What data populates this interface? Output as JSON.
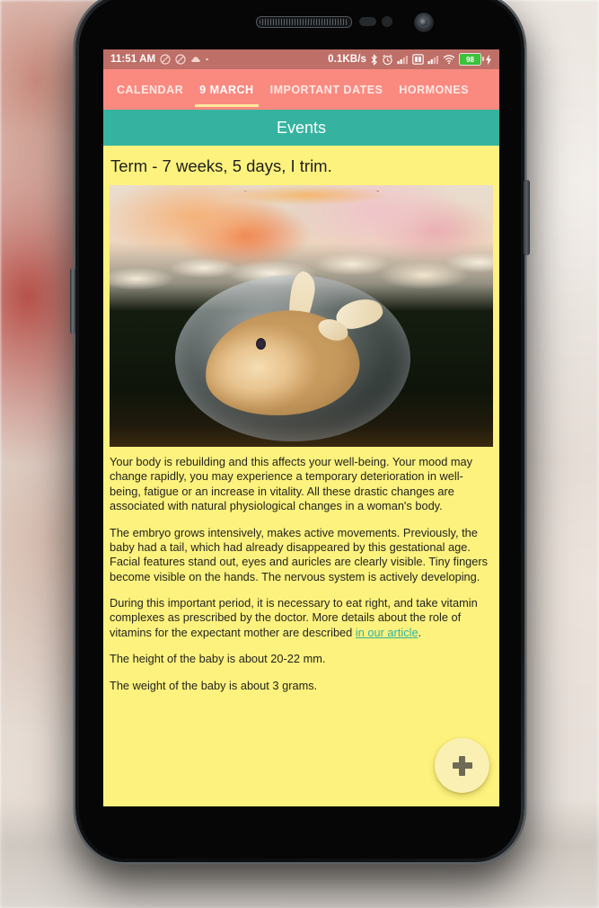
{
  "status_bar": {
    "time": "11:51 AM",
    "icons_left": [
      "mute-icon",
      "mute-icon",
      "cloud-icon",
      "dot-icon"
    ],
    "network_speed": "0.1KB/s",
    "icons_right": [
      "bluetooth-icon",
      "alarm-icon",
      "signal-icon",
      "dual-sim-icon",
      "signal-icon",
      "wifi-icon"
    ],
    "battery_level": "98",
    "charging": true
  },
  "tabs": [
    {
      "label": "CALENDAR",
      "active": false
    },
    {
      "label": "9 MARCH",
      "active": true
    },
    {
      "label": "IMPORTANT DATES",
      "active": false
    },
    {
      "label": "HORMONES",
      "active": false
    }
  ],
  "section_header": {
    "title": "Events"
  },
  "content": {
    "term_title": "Term - 7 weeks, 5 days, I trim.",
    "hero_image_alt": "embryo-in-amniotic-sac-photo",
    "paragraphs": [
      "Your body is rebuilding and this affects your well-being. Your mood may change rapidly, you may experience a temporary deterioration in well-being, fatigue or an increase in vitality. All these drastic changes are associated with natural physiological changes in a woman's body.",
      "The embryo grows intensively, makes active movements. Previously, the baby had a tail, which had already disappeared by this gestational age. Facial features stand out, eyes and auricles are clearly visible. Tiny fingers become visible on the hands. The nervous system is actively developing."
    ],
    "vitamins_paragraph": {
      "before_link": "During this important period, it is necessary to eat right, and take vitamin complexes as prescribed by the doctor. More details about the role of vitamins for the expectant mother are described ",
      "link_text": "in our article",
      "after_link": "."
    },
    "height_line": "The height of the baby is about 20-22 mm.",
    "weight_line": "The weight of the baby is about 3 grams."
  },
  "fab": {
    "icon": "plus-icon",
    "label": "Add event"
  },
  "colors": {
    "status_bar": "#bd6f68",
    "app_bar": "#fa8a80",
    "tab_indicator": "#fbe9a0",
    "section_header": "#36b3a0",
    "content_background": "#fdf27d",
    "link": "#2fb3a0",
    "fab_background": "#fbf0b4",
    "battery": "#3cc13c"
  }
}
